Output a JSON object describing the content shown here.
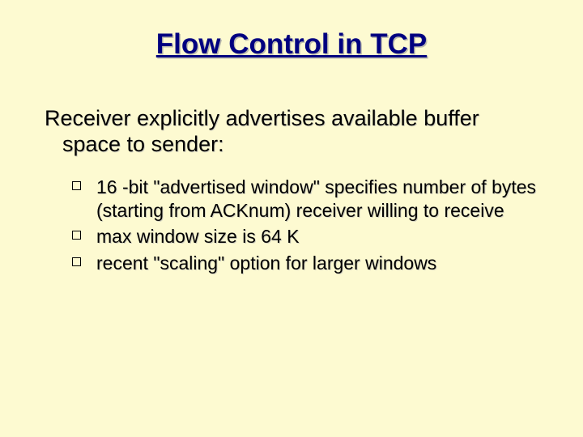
{
  "title": "Flow Control in TCP",
  "lead_line1": "Receiver explicitly advertises available buffer",
  "lead_line2": "space to sender:",
  "bullets": [
    "16 -bit \"advertised window\" specifies number of bytes (starting from ACKnum) receiver willing to receive",
    "max window size is 64 K",
    "recent \"scaling\" option for larger windows"
  ]
}
